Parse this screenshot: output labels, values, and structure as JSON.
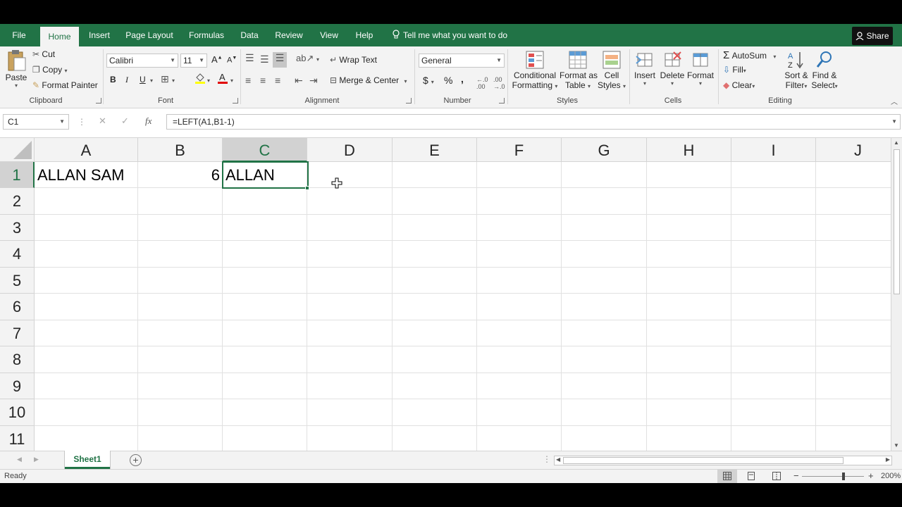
{
  "ribbon_tabs": [
    {
      "label": "File",
      "active": false
    },
    {
      "label": "Home",
      "active": true
    },
    {
      "label": "Insert",
      "active": false
    },
    {
      "label": "Page Layout",
      "active": false
    },
    {
      "label": "Formulas",
      "active": false
    },
    {
      "label": "Data",
      "active": false
    },
    {
      "label": "Review",
      "active": false
    },
    {
      "label": "View",
      "active": false
    },
    {
      "label": "Help",
      "active": false
    }
  ],
  "tell_me": "Tell me what you want to do",
  "share_label": "Share",
  "clipboard": {
    "paste": "Paste",
    "cut": "Cut",
    "copy": "Copy",
    "format_painter": "Format Painter",
    "group": "Clipboard"
  },
  "font": {
    "name": "Calibri",
    "size": "11",
    "bold": "B",
    "italic": "I",
    "underline": "U",
    "group": "Font"
  },
  "alignment": {
    "wrap_text": "Wrap Text",
    "merge_center": "Merge & Center",
    "group": "Alignment"
  },
  "number": {
    "format": "General",
    "currency": "$",
    "percent": "%",
    "comma": ",",
    "group": "Number"
  },
  "styles": {
    "conditional": "Conditional",
    "conditional2": "Formatting",
    "format_as": "Format as",
    "format_as2": "Table",
    "cell": "Cell",
    "cell2": "Styles",
    "group": "Styles"
  },
  "cells": {
    "insert": "Insert",
    "delete": "Delete",
    "format": "Format",
    "group": "Cells"
  },
  "editing": {
    "autosum": "AutoSum",
    "fill": "Fill",
    "clear": "Clear",
    "sort": "Sort &",
    "sort2": "Filter",
    "find": "Find &",
    "find2": "Select",
    "group": "Editing"
  },
  "formula_bar": {
    "name_box": "C1",
    "formula": "=LEFT(A1,B1-1)",
    "fx": "fx"
  },
  "columns": [
    "A",
    "B",
    "C",
    "D",
    "E",
    "F",
    "G",
    "H",
    "I",
    "J"
  ],
  "rows": [
    "1",
    "2",
    "3",
    "4",
    "5",
    "6",
    "7",
    "8",
    "9",
    "10",
    "11"
  ],
  "cells_data": {
    "A1": "ALLAN SAM",
    "B1": "6",
    "C1": "ALLAN"
  },
  "selected_cell": "C1",
  "sheet_tab": "Sheet1",
  "status": {
    "ready": "Ready",
    "zoom": "200%"
  },
  "colors": {
    "accent": "#217346"
  }
}
